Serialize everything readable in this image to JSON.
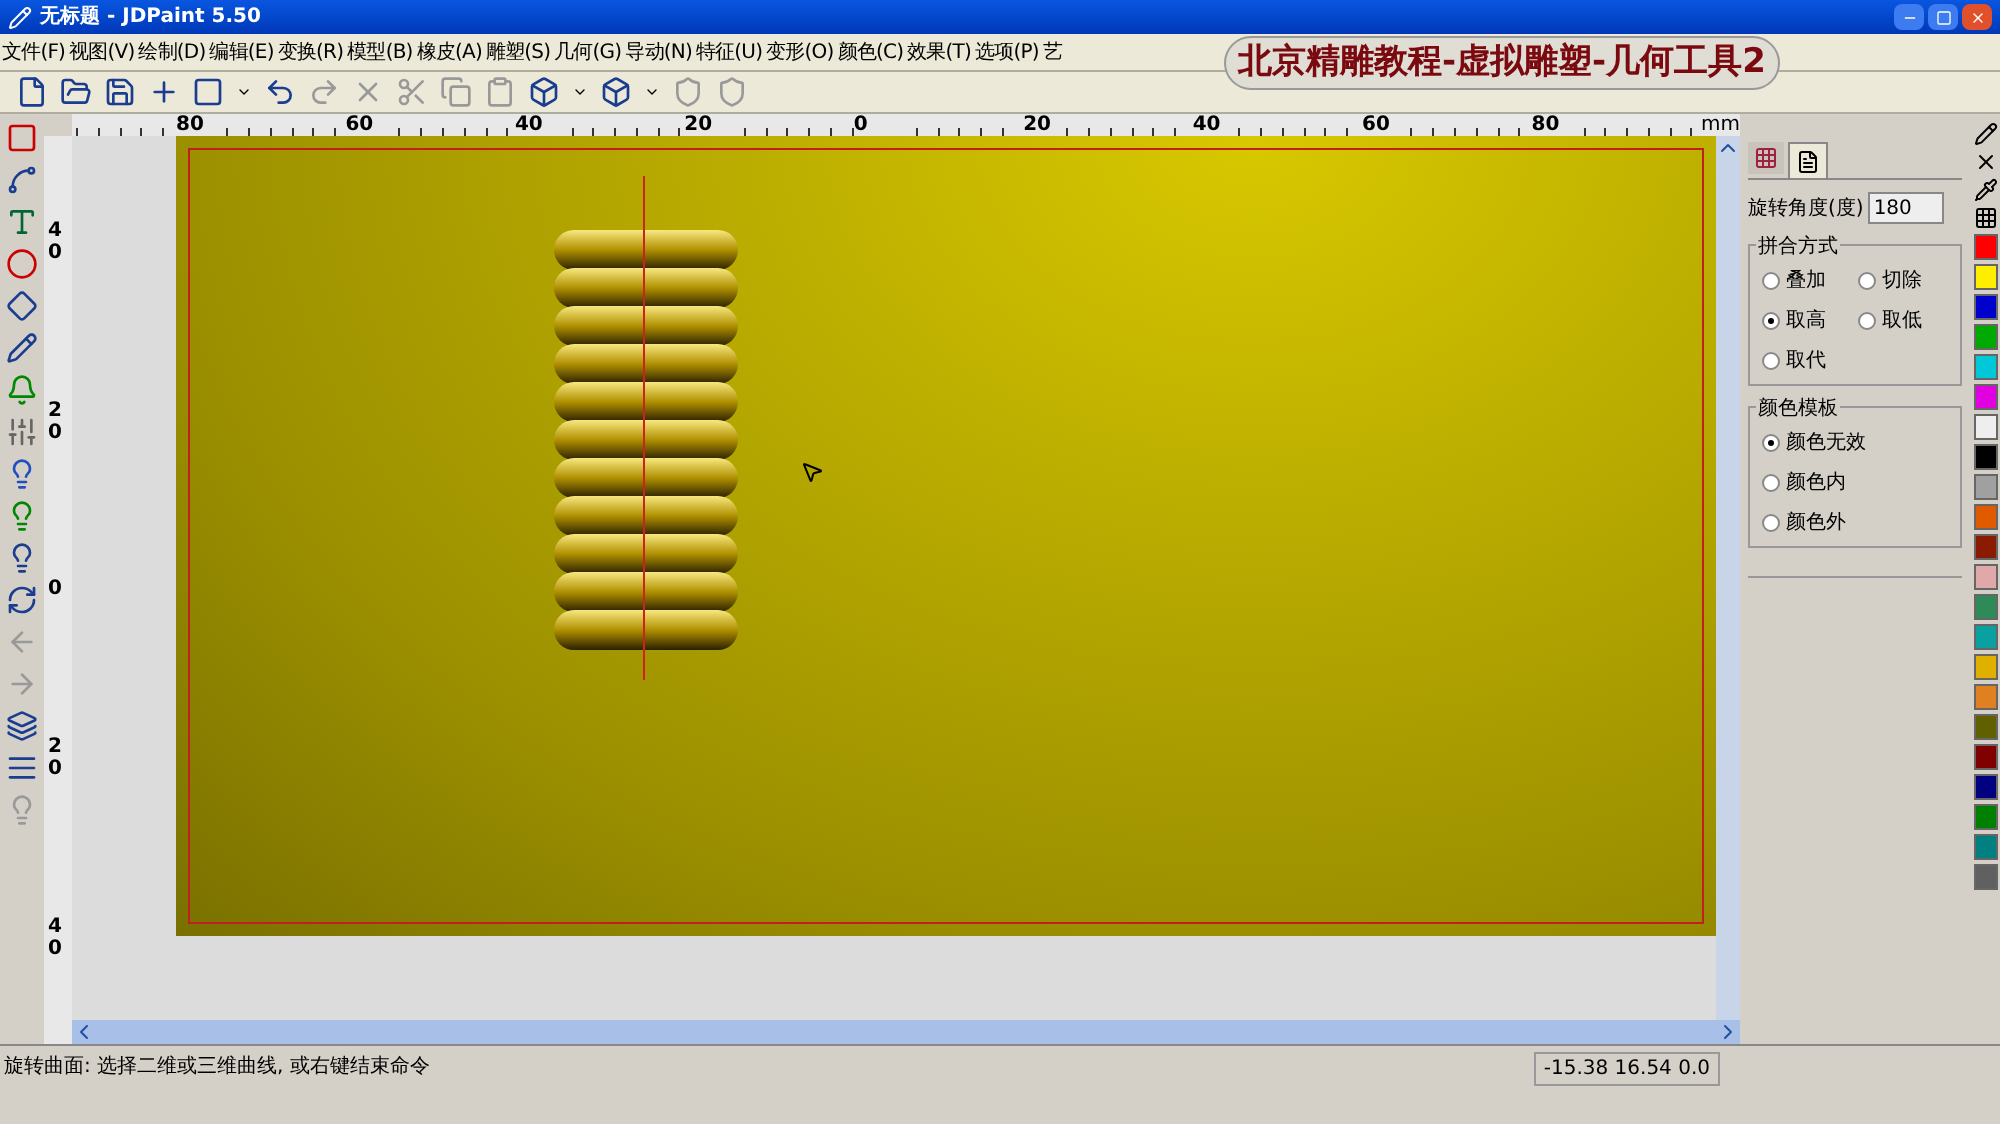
{
  "window": {
    "title": "无标题 - JDPaint 5.50"
  },
  "overlay_title": "北京精雕教程-虚拟雕塑-几何工具2",
  "menu": [
    "文件(F)",
    "视图(V)",
    "绘制(D)",
    "编辑(E)",
    "变换(R)",
    "模型(B)",
    "橡皮(A)",
    "雕塑(S)",
    "几何(G)",
    "导动(N)",
    "特征(U)",
    "变形(O)",
    "颜色(C)",
    "效果(T)",
    "选项(P)",
    "艺"
  ],
  "ruler_h": [
    "80",
    "60",
    "40",
    "20",
    "0",
    "20",
    "40",
    "60",
    "80"
  ],
  "ruler_unit": "mm",
  "ruler_v": [
    "40",
    "20",
    "0",
    "20",
    "40"
  ],
  "panel": {
    "tabs": [
      {
        "selected": false
      },
      {
        "selected": true
      }
    ],
    "angle": {
      "label": "旋转角度(度)",
      "value": "180"
    },
    "groups": [
      {
        "title": "拼合方式",
        "options": [
          {
            "label": "叠加",
            "selected": false
          },
          {
            "label": "切除",
            "selected": false
          },
          {
            "label": "取高",
            "selected": true
          },
          {
            "label": "取低",
            "selected": false
          },
          {
            "label": "取代",
            "selected": false
          }
        ]
      },
      {
        "title": "颜色模板",
        "options": [
          {
            "label": "颜色无效",
            "selected": true
          },
          {
            "label": "颜色内",
            "selected": false
          },
          {
            "label": "颜色外",
            "selected": false
          }
        ]
      }
    ]
  },
  "palette": [
    {
      "color": "#ff0000"
    },
    {
      "color": "#ffee00"
    },
    {
      "color": "#0000cc"
    },
    {
      "color": "#00aa00"
    },
    {
      "color": "#00c8d8"
    },
    {
      "color": "#e000e0"
    },
    {
      "color": "#eeeeee"
    },
    {
      "color": "#000000"
    },
    {
      "color": "#a0a0a0"
    },
    {
      "color": "#e05a00"
    },
    {
      "color": "#8a1a00"
    },
    {
      "color": "#e0a8a8"
    },
    {
      "color": "#2e8b57"
    },
    {
      "color": "#0aa0a0"
    },
    {
      "color": "#e0b000"
    },
    {
      "color": "#e08020"
    },
    {
      "color": "#606000"
    },
    {
      "color": "#800000"
    },
    {
      "color": "#000080"
    },
    {
      "color": "#008000"
    },
    {
      "color": "#008080"
    },
    {
      "color": "#606060"
    }
  ],
  "status": {
    "prompt": "旋转曲面: 选择二维或三维曲线, 或右键结束命令",
    "coords": "-15.38 16.54 0.0"
  }
}
